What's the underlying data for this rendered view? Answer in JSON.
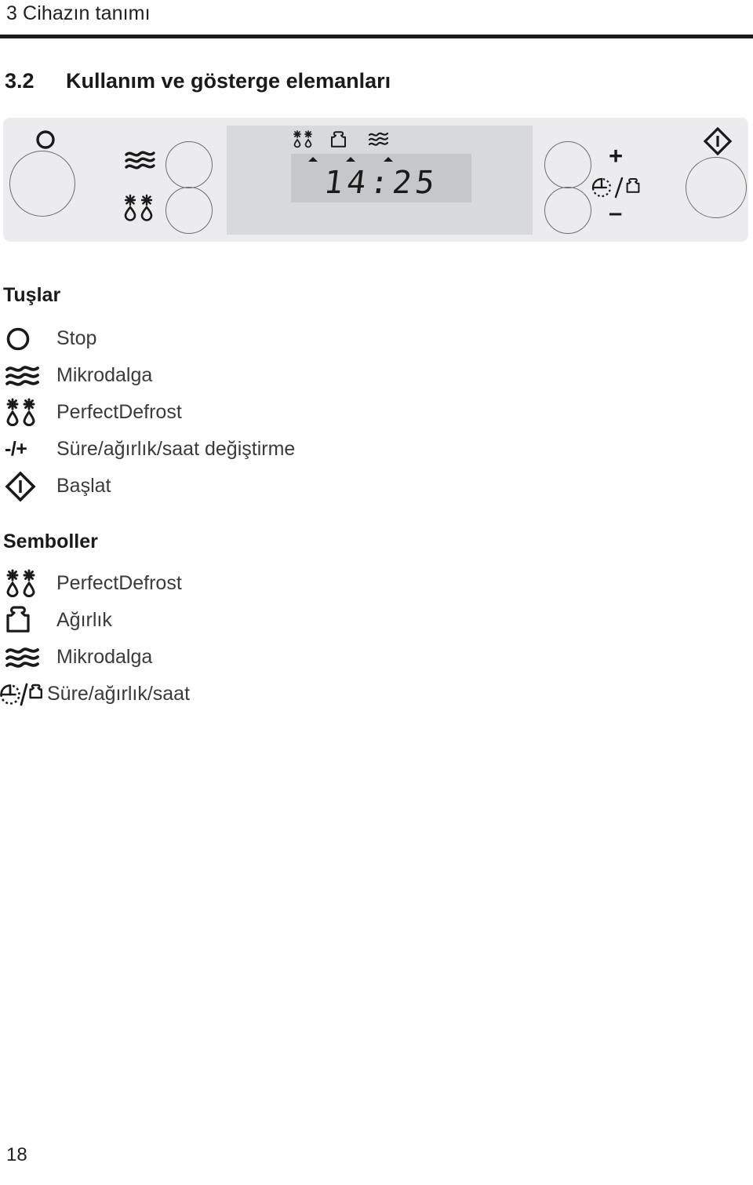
{
  "header": {
    "chapter_number": "3",
    "chapter_title": "Cihazın tanımı",
    "running_head": "3 Cihazın tanımı"
  },
  "section": {
    "number": "3.2",
    "title": "Kullanım ve gösterge elemanları"
  },
  "control_panel": {
    "stop_key_icon": "circle-icon",
    "microwave_key_icon": "microwave-waves-icon",
    "perfectdefrost_key_icon": "snowflake-droplet-icon",
    "plus_label": "+",
    "minus_label": "–",
    "time_weight_icon": "clock-weight-icon",
    "start_key_icon": "diamond-power-icon",
    "display": {
      "indicator_icons": [
        "snowflake-droplet-icon",
        "weight-icon",
        "microwave-waves-icon"
      ],
      "lcd_value": "14:25"
    }
  },
  "keys_section": {
    "heading": "Tuşlar",
    "items": [
      {
        "icon": "circle-icon",
        "glyph": "",
        "label": "Stop"
      },
      {
        "icon": "microwave-waves-icon",
        "glyph": "",
        "label": "Mikrodalga"
      },
      {
        "icon": "snowflake-droplet-icon",
        "glyph": "",
        "label": "PerfectDefrost"
      },
      {
        "icon": "minus-plus-text",
        "glyph": "-/+",
        "label": "Süre/ağırlık/saat değiştirme"
      },
      {
        "icon": "diamond-power-icon",
        "glyph": "",
        "label": "Başlat"
      }
    ]
  },
  "symbols_section": {
    "heading": "Semboller",
    "items": [
      {
        "icon": "snowflake-droplet-icon",
        "glyph": "",
        "label": "PerfectDefrost"
      },
      {
        "icon": "weight-icon",
        "glyph": "",
        "label": "Ağırlık"
      },
      {
        "icon": "microwave-waves-icon",
        "glyph": "",
        "label": "Mikrodalga"
      },
      {
        "icon": "clock-weight-icon",
        "glyph": "",
        "label": "Süre/ağırlık/saat"
      }
    ]
  },
  "footer": {
    "page_number": "18"
  },
  "colors": {
    "text": "#231f20",
    "panel_bg": "#ececee",
    "display_bg": "#d8d9db",
    "lcd_bg": "#c6c7c9",
    "rule": "#1a1a1a"
  }
}
